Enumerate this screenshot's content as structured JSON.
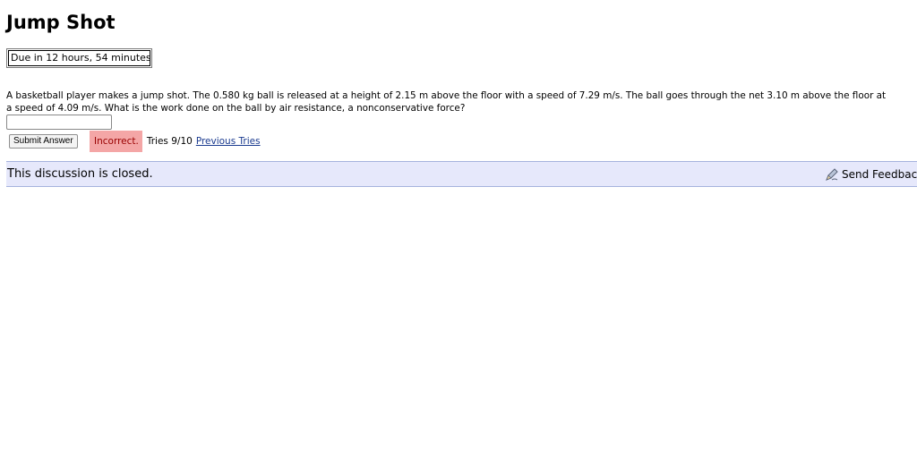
{
  "page": {
    "title": "Jump Shot",
    "due": "Due in 12 hours, 54 minutes"
  },
  "problem": {
    "line1": "A basketball player makes a jump shot. The 0.580 kg ball is released at a height of 2.15 m above the floor with a speed of 7.29 m/s. The ball goes through the net 3.10 m above the floor at",
    "line2": "a speed of 4.09 m/s. What is the work done on the ball by air resistance, a nonconservative force?"
  },
  "answer": {
    "value": "",
    "submit_label": "Submit Answer",
    "status": "Incorrect.",
    "tries": "Tries 9/10",
    "previous_tries_link": "Previous Tries"
  },
  "discussion": {
    "status": "This discussion is closed.",
    "send_feedback": "Send Feedback",
    "send_feedback_icon": "pen-icon"
  },
  "colors": {
    "incorrect_bg": "#f4a6a6",
    "discussion_bg": "#e6e8fb",
    "link": "#1a3a8f"
  }
}
